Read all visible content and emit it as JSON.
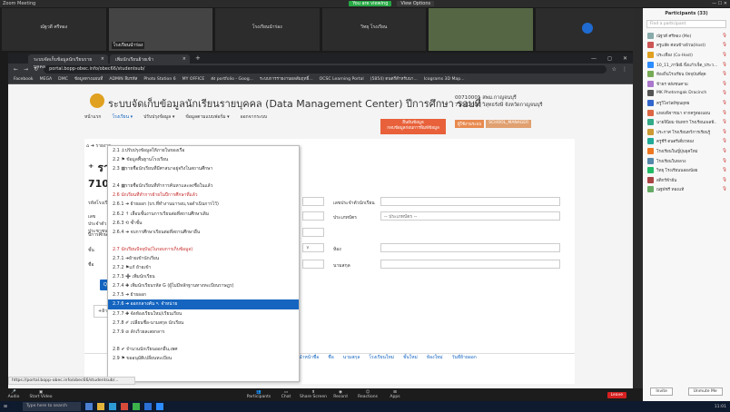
{
  "zoom": {
    "title": "Zoom Meeting",
    "recording": "You are viewing",
    "view_options": "View Options",
    "window_controls": "—  ☐  ✕"
  },
  "thumbs": [
    {
      "name": "ณัฐวดี  ศรีทอง",
      "caption": ""
    },
    {
      "name": "โรงเรียนนำร่อง",
      "caption": "โรงเรียนนำร่อง"
    },
    {
      "name": "วิทยุ โรงเรียน",
      "caption": "วิทยุ โรงเรียน"
    },
    {
      "name": "ครูประจำวิชา",
      "caption": ""
    },
    {
      "name": "",
      "caption": ""
    }
  ],
  "browser": {
    "tabs": [
      {
        "label": "ระบบจัดเก็บข้อมูลนักเรียนรายบุคคล"
      },
      {
        "label": "เพิ่มนักเรียนย้ายเข้า"
      }
    ],
    "url": "portal.bopp-obec.info/obec66/studentsub/",
    "bookmarks": [
      "Facebook",
      "MEGA",
      "DMC",
      "ข้อมูลทางแผนที่",
      "ADMIN ลืมรหัส",
      "Photo Station 6",
      "MY OFFICE",
      "ส่ง portfolio - Goog...",
      "ระบบการรายงานผลสัมฤทธิ์...",
      "OCSC Learning Portal",
      "(5854) ดนตรีสำหรับนา...",
      "Icograms 3D Map..."
    ]
  },
  "page": {
    "header": "ระบบจัดเก็บข้อมูลนักเรียนรายบุคคล (Data Management Center) ปีการศึกษา รอบที่",
    "school_code": "00710001 สพม.กาญจนบุรี",
    "school_name": "71012006 วิสุทธรังษี จังหวัดกาญจนบุรี",
    "nav": [
      "หน้าแรก",
      "โรงเรียน ▾",
      "ปรับปรุงข้อมูล ▾",
      "ข้อมูลตามแบบฟอร์ม ▾",
      "ออกจากระบบ"
    ],
    "confirm_button": "ยืนยันข้อมูล\nกลบข้อมูลก่อนการพิมพ์ข้อมูล",
    "roles": [
      "ผู้ใช้งานระบบ",
      "SCHOOL_MANAGER"
    ],
    "breadcrumb": "⌂  ➜  รายงาน",
    "title1": "⁺ ราย",
    "title2": "710120",
    "labels": {
      "student_id": "รหัสโรงเรียน",
      "id_type": "เลขประจำตัว ประชาชน",
      "grade": "ปีการศึกษา",
      "class": "ชั้น",
      "name": "ชื่อ",
      "id_card": "เลขประจำตัวนักเรียน",
      "nationality": "ประเภทบัตร",
      "room": "ห้อง",
      "surname": "นามสกุล"
    },
    "select_placeholder": "-- ประเภทบัตร --",
    "search_btn": "Qค้นหา",
    "add_btn": "+ย้ายออก",
    "table_headers": [
      "คำนำหน้าชื่อ",
      "ชื่อ",
      "นามสกุล",
      "โรงเรียนใหม่",
      "ชั้นใหม่",
      "ห้องใหม่",
      "วันที่ย้ายออก"
    ]
  },
  "menu": [
    {
      "t": "2.1 ⚓ปรับปรุงข้อมูลให้ภายในของเรือ",
      "k": ""
    },
    {
      "t": "2.2 ⚑ ข้อมูลพื้นฐานโรงเรียน",
      "k": ""
    },
    {
      "t": "2.3 ▦รายชื่อนักเรียนที่มีศาสนาอยู่จริงในสถานศึกษา",
      "k": ""
    },
    {
      "t": "",
      "k": "gap"
    },
    {
      "t": "2.4 ▦รายชื่อนักเรียนที่ทำการค้นหาและลงชื่อในแล้ว",
      "k": ""
    },
    {
      "t": "2.6 นักเรียนที่ทำการย้ายในปีการศึกษาที่แล้ว",
      "k": "red"
    },
    {
      "t": "2.6.1 ➜ ย้ายออก (บร.ที่ทำงานมารอบ,รอดำเนินการไว้)",
      "k": ""
    },
    {
      "t": "2.6.2 ↑ เลื่อนชั้นงานการเรียนต่อที่สถานศึกษาเดิม",
      "k": ""
    },
    {
      "t": "2.6.3 ⟲ ซ้ำชั้น",
      "k": ""
    },
    {
      "t": "2.6.4 ➜ จบการศึกษาเรียนต่อที่สถานศึกษาอื่น",
      "k": ""
    },
    {
      "t": "",
      "k": "gap"
    },
    {
      "t": "2.7 นักเรียนปัจจุบัน(ในรอบการเก็บข้อมูล)",
      "k": "red"
    },
    {
      "t": "2.7.1 ➜ย้ายเข้านักเรียน",
      "k": ""
    },
    {
      "t": "2.7.2 ⚑แก้ ย้ายเข้า",
      "k": ""
    },
    {
      "t": "2.7.3 ➕ เพิ่มนักเรียน",
      "k": ""
    },
    {
      "t": "2.7.4 ✚ เพิ่มนักเรียนรหัส G (ผู้ไม่มีหลักฐานทางทะเบียนราษฎร)",
      "k": ""
    },
    {
      "t": "2.7.5 ➜ ย้ายออก",
      "k": ""
    },
    {
      "t": "2.7.6 ➜ ออกกลางคัน ↖ จำหน่าย",
      "k": "sel"
    },
    {
      "t": "2.7.7 ✚ จัดห้องเรียนใหม่/เรียนเรียน",
      "k": ""
    },
    {
      "t": "2.7.8 ✐ เปลี่ยนชื่อ-นามสกุล นักเรียน",
      "k": ""
    },
    {
      "t": "2.7.9 ⊘ ลักเร็วผลเลยกลาร",
      "k": ""
    },
    {
      "t": "",
      "k": "gap"
    },
    {
      "t": "2.8 ✔ จำนวนนักเรียนออกอื่น,เพศ",
      "k": ""
    },
    {
      "t": "2.9 ⚑ ขออนุมัติเปลี่ยนทะเบียน",
      "k": ""
    }
  ],
  "status_url": "https://portal.bopp-obec.info/obec66/studentsub/...",
  "zoom_controls": [
    "Audio",
    "Start Video",
    "Participants",
    "Chat",
    "Share Screen",
    "Record",
    "Reactions",
    "Apps"
  ],
  "zoom_end": "Leave",
  "taskbar": {
    "search": "Type here to search",
    "time": "11:01"
  },
  "participants": {
    "title": "Participants (33)",
    "search": "Find a participant",
    "list": [
      "ณัฐวดี  ศรีทอง (Me)",
      "ครูแอ๊ด ค่อนข้างอ้วน(Host)",
      "ประเทือง (Co-Host)",
      "10_11_ภาษิณี พึ่งแก้วเจ็ด_ประว...",
      "ท้องถิ่นโรงเรียน ปัจจุบันที่สุด",
      "ข้าธร หลังชนคาม",
      "MK Phetnmgak Dracinch",
      "ครูวิไลวัลย์ชุณยุทธ",
      "แหล่งพิจารณา จากครูสองแผน",
      "นายจินิยม จันทกร โรงเรียนเพลฟ้..",
      "ประกาศ โรงเรียนทวีการเรียนรู้",
      "ครูชีรี ดนตรีเดี่ยวทอง",
      "โรงเรียนในญี่ปุ่นยุคใหม่",
      "โรงเรียนในหลวง",
      "วิทยุ โรงเรียนนลองน้อย",
      "สติกร์ฟ้าฝัน",
      "ณฐพัชรี ทองแท้"
    ],
    "footer": [
      "Invite",
      "Unmute Me"
    ]
  }
}
